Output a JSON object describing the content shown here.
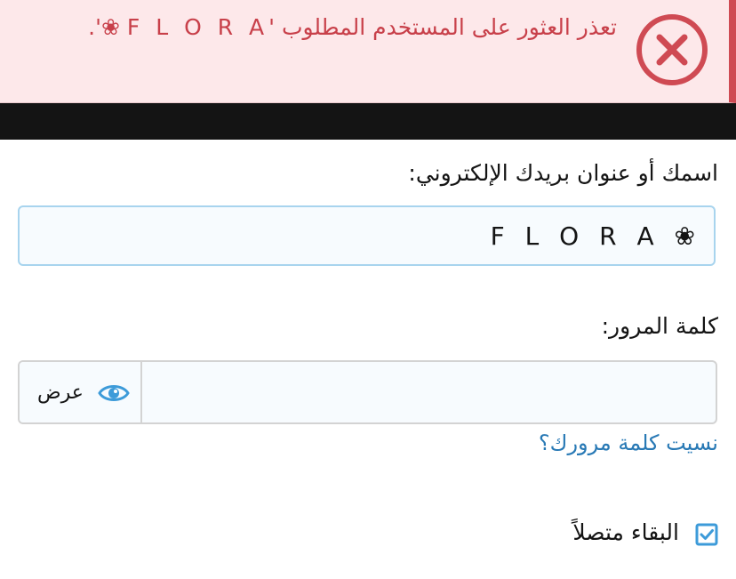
{
  "error": {
    "message_prefix": "تعذر العثور على المستخدم المطلوب '",
    "username": "❀ F L O R A",
    "message_suffix": "'.",
    "icon": "close-circle-icon",
    "color": "#c8404a",
    "background": "#fde8ea"
  },
  "form": {
    "username_label": "اسمك أو عنوان بريدك الإلكتروني:",
    "username_value": "❀ F L O R A",
    "password_label": "كلمة المرور:",
    "password_value": "",
    "show_label": "عرض",
    "show_icon": "eye-icon",
    "forgot_link": "نسيت كلمة مرورك؟",
    "remember_label": "البقاء متصلاً",
    "remember_checked": true
  },
  "colors": {
    "accent": "#2879b5",
    "input_focus_border": "#a8d4ee",
    "checkbox": "#3d9bd9",
    "dark_bar": "#141414"
  }
}
